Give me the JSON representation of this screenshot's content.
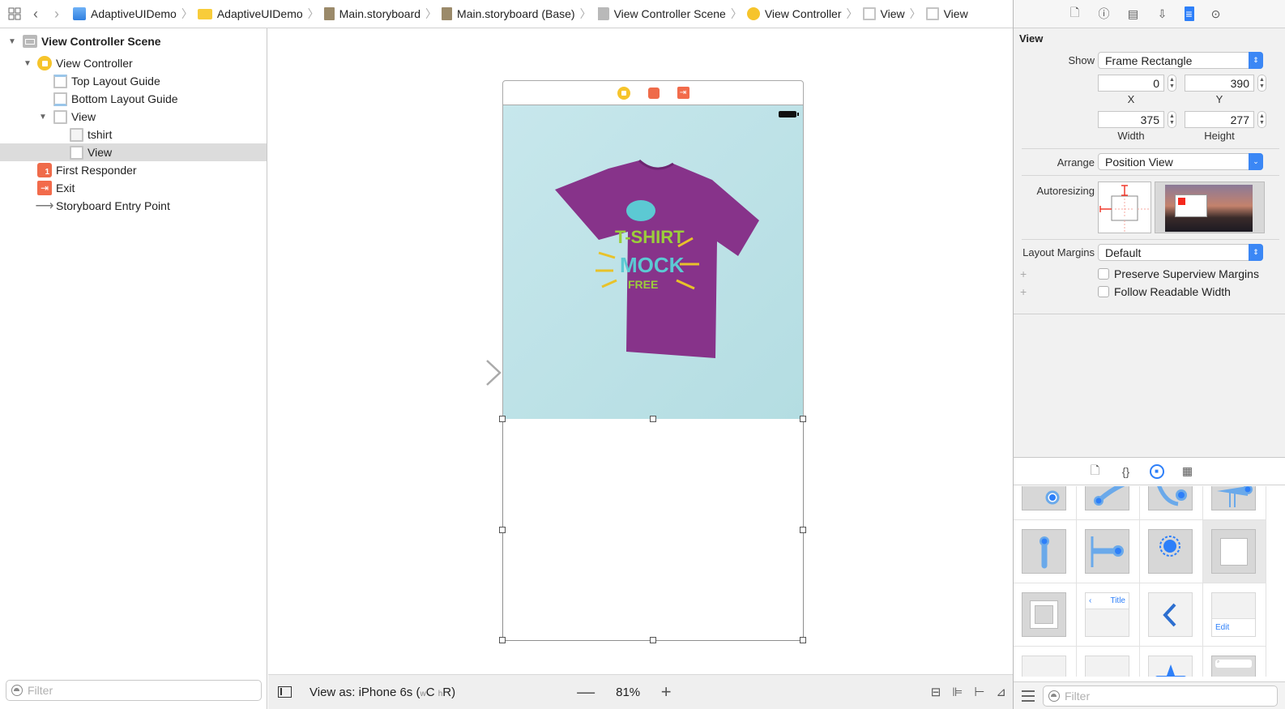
{
  "jumpbar": {
    "breadcrumbs": [
      {
        "label": "AdaptiveUIDemo",
        "icon": "app-project-icon"
      },
      {
        "label": "AdaptiveUIDemo",
        "icon": "folder-icon"
      },
      {
        "label": "Main.storyboard",
        "icon": "storyboard-file-icon"
      },
      {
        "label": "Main.storyboard (Base)",
        "icon": "storyboard-file-icon"
      },
      {
        "label": "View Controller Scene",
        "icon": "scene-icon"
      },
      {
        "label": "View Controller",
        "icon": "view-controller-icon"
      },
      {
        "label": "View",
        "icon": "view-icon"
      },
      {
        "label": "View",
        "icon": "view-icon"
      }
    ]
  },
  "navigator": {
    "tree": [
      {
        "label": "View Controller Scene",
        "icon": "scene-icon",
        "expanded": true,
        "level": 0
      },
      {
        "label": "View Controller",
        "icon": "view-controller-icon",
        "expanded": true,
        "level": 1
      },
      {
        "label": "Top Layout Guide",
        "icon": "layout-guide-icon",
        "level": 2
      },
      {
        "label": "Bottom Layout Guide",
        "icon": "layout-guide-icon",
        "level": 2
      },
      {
        "label": "View",
        "icon": "view-icon",
        "expanded": true,
        "level": 2
      },
      {
        "label": "tshirt",
        "icon": "image-view-icon",
        "level": 3
      },
      {
        "label": "View",
        "icon": "view-icon",
        "level": 3,
        "selected": true
      },
      {
        "label": "First Responder",
        "icon": "first-responder-icon",
        "level": 1
      },
      {
        "label": "Exit",
        "icon": "exit-icon",
        "level": 1
      },
      {
        "label": "Storyboard Entry Point",
        "icon": "entry-arrow-icon",
        "level": 1
      }
    ],
    "filter_placeholder": "Filter"
  },
  "canvas": {
    "bottom_bar": {
      "view_as_prefix": "View as: iPhone 6s (",
      "size_class_w": "w",
      "size_class_w_val": "C",
      "size_class_h": "h",
      "size_class_h_val": "R)",
      "zoom_minus": "—",
      "zoom_level": "81%",
      "zoom_plus": "+"
    }
  },
  "inspector": {
    "section_title": "View",
    "show_label": "Show",
    "show_value": "Frame Rectangle",
    "x_value": "0",
    "y_value": "390",
    "x_label": "X",
    "y_label": "Y",
    "width_value": "375",
    "height_value": "277",
    "width_label": "Width",
    "height_label": "Height",
    "arrange_label": "Arrange",
    "arrange_value": "Position View",
    "autoresizing_label": "Autoresizing",
    "layout_margins_label": "Layout Margins",
    "layout_margins_value": "Default",
    "preserve_superview_margins": {
      "label": "Preserve Superview Margins",
      "checked": false
    },
    "follow_readable_width": {
      "label": "Follow Readable Width",
      "checked": false
    }
  },
  "library": {
    "filter_placeholder": "Filter",
    "cells": [
      {
        "name": "tap-gesture-recognizer"
      },
      {
        "name": "pinch-gesture-recognizer"
      },
      {
        "name": "rotation-gesture-recognizer"
      },
      {
        "name": "swipe-gesture-recognizer"
      },
      {
        "name": "pan-gesture-recognizer"
      },
      {
        "name": "screen-edge-pan-gesture-recognizer"
      },
      {
        "name": "long-press-gesture-recognizer"
      },
      {
        "name": "custom-gesture-recognizer"
      },
      {
        "name": "view-object"
      },
      {
        "name": "navigation-item",
        "title": "Title"
      },
      {
        "name": "bar-button-item-back"
      },
      {
        "name": "bar-button-item-edit",
        "title": "Edit"
      }
    ]
  },
  "colors": {
    "accent": "#2d7ff9",
    "tshirt_purple": "#8a3a8e",
    "image_bg": "#c1e4e8",
    "view_controller_yellow": "#f6c42b",
    "exit_orange": "#f26b4b"
  }
}
